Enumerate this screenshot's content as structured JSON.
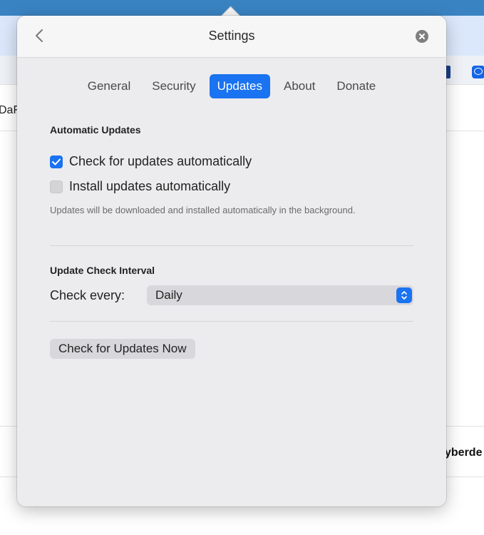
{
  "background": {
    "left_text": "DaF",
    "right_text": "yberde"
  },
  "header": {
    "title": "Settings",
    "back_icon": "chevron-left-icon",
    "close_icon": "close-icon"
  },
  "tabs": [
    {
      "label": "General",
      "active": false
    },
    {
      "label": "Security",
      "active": false
    },
    {
      "label": "Updates",
      "active": true
    },
    {
      "label": "About",
      "active": false
    },
    {
      "label": "Donate",
      "active": false
    }
  ],
  "automatic_updates": {
    "title": "Automatic Updates",
    "check_label": "Check for updates automatically",
    "check_checked": true,
    "install_label": "Install updates automatically",
    "install_checked": false,
    "hint": "Updates will be downloaded and installed automatically in the background."
  },
  "interval": {
    "title": "Update Check Interval",
    "label": "Check every:",
    "selected": "Daily"
  },
  "actions": {
    "check_now_label": "Check for Updates Now"
  },
  "colors": {
    "accent": "#1a73f0",
    "panel": "#ececee"
  }
}
